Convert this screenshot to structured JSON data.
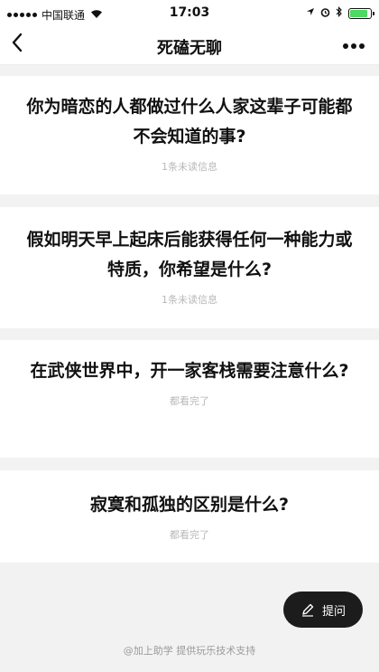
{
  "status_bar": {
    "carrier": "中国联通",
    "time": "17:03",
    "battery_level": 0.85
  },
  "nav": {
    "title": "死磕无聊"
  },
  "cards": [
    {
      "title": "你为暗恋的人都做过什么人家这辈子可能都不会知道的事?",
      "status": "1条未读信息"
    },
    {
      "title": "假如明天早上起床后能获得任何一种能力或特质，你希望是什么?",
      "status": "1条未读信息"
    },
    {
      "title": "在武侠世界中，开一家客栈需要注意什么?",
      "status": "都看完了"
    },
    {
      "title": "寂寞和孤独的区别是什么?",
      "status": "都看完了"
    }
  ],
  "ask_button": {
    "label": "提问"
  },
  "footer": {
    "support": "@加上助学 提供玩乐技术支持"
  }
}
